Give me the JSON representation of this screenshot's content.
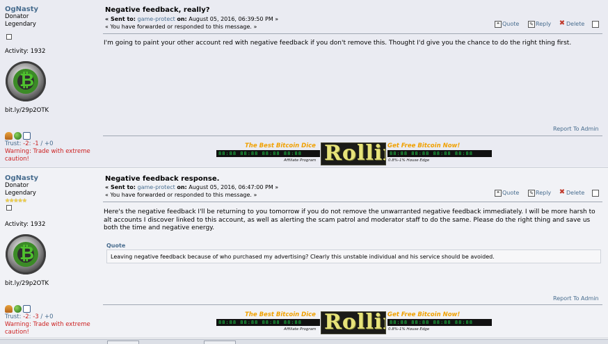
{
  "messages": [
    {
      "poster": {
        "name": "OgNasty",
        "rank1": "Donator",
        "rank2": "Legendary",
        "stars": "",
        "activity": "Activity: 1932",
        "website": "bit.ly/29p2OTK",
        "trust_label": "Trust:",
        "trust_a": "-2",
        "trust_sep1": ":",
        "trust_b": "-1",
        "trust_sep2": "/",
        "trust_c": "+0",
        "warning": "Warning: Trade with extreme caution!"
      },
      "subject": "Negative feedback, really?",
      "sent_prefix": "« Sent to:",
      "sent_to": "game-protect",
      "sent_on_label": "on:",
      "sent_date": "August 05, 2016, 06:39:50 PM »",
      "forwarded": "« You have forwarded or responded to this message. »",
      "actions": {
        "quote": "Quote",
        "reply": "Reply",
        "delete": "Delete"
      },
      "body": "I'm going to paint your other account red with negative feedback if you don't remove this.  Thought I'd give you the chance to do the right thing first.",
      "report": "Report To Admin"
    },
    {
      "poster": {
        "name": "OgNasty",
        "rank1": "Donator",
        "rank2": "Legendary",
        "stars": "★★★★★",
        "activity": "Activity: 1932",
        "website": "bit.ly/29p2OTK",
        "trust_label": "Trust:",
        "trust_a": "-2",
        "trust_sep1": ":",
        "trust_b": "-3",
        "trust_sep2": "/",
        "trust_c": "+0",
        "warning": "Warning: Trade with extreme caution!"
      },
      "subject": "Negative feedback response.",
      "sent_prefix": "« Sent to:",
      "sent_to": "game-protect",
      "sent_on_label": "on:",
      "sent_date": "August 05, 2016, 06:47:00 PM »",
      "forwarded": "« You have forwarded or responded to this message. »",
      "actions": {
        "quote": "Quote",
        "reply": "Reply",
        "delete": "Delete"
      },
      "body": "Here's the negative feedback I'll be returning to you tomorrow if you do not remove the unwarranted negative feedback immediately.  I will be more harsh to alt accounts I discover linked to this account, as well as alerting the scam patrol and moderator staff to do the same.  Please do the right thing and save us both the time and negative energy.",
      "quote_header": "Quote",
      "quote_text": "Leaving negative feedback because of who purchased my advertising?  Clearly this unstable individual and his service should be avoided.",
      "report": "Report To Admin"
    }
  ],
  "ad": {
    "left_top": "The Best Bitcoin Dice",
    "right_top": "Get Free Bitcoin Now!",
    "logo": "Rollin",
    "left_bottom": "Affiliate Program",
    "right_bottom": "0.8%-1% House Edge",
    "ticker": "88:88 88:88 88:88 88:88"
  },
  "icons": {
    "people": "people-icon",
    "globe": "globe-icon",
    "pm": "pm-icon",
    "quote": "quote-icon",
    "reply": "reply-icon",
    "delete": "delete-icon"
  }
}
